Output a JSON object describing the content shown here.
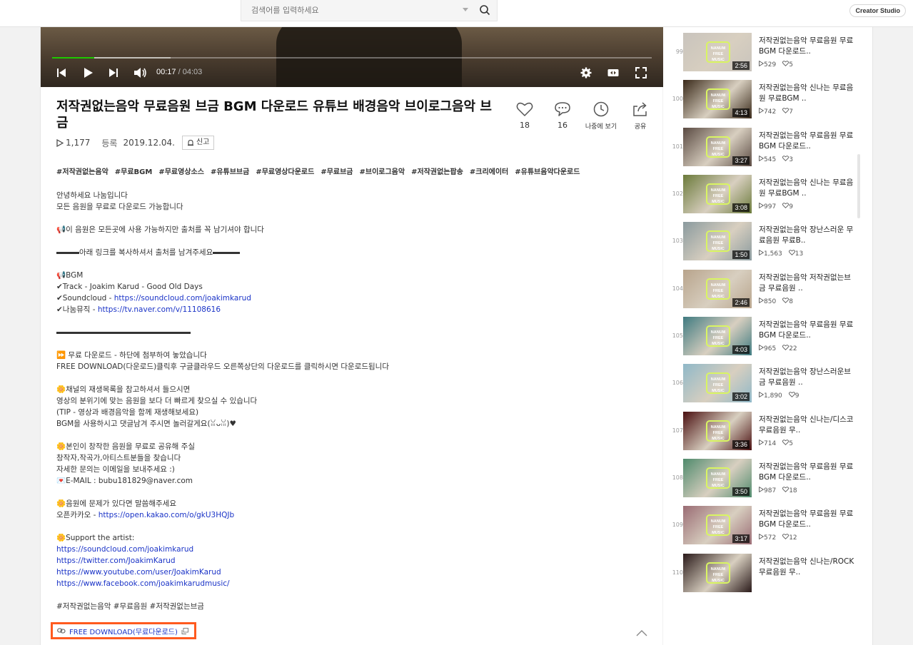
{
  "search": {
    "placeholder": "검색어를 입력하세요"
  },
  "header": {
    "creator_studio": "Creator Studio"
  },
  "player": {
    "current_time": "00:17",
    "separator": "/",
    "total_time": "04:03",
    "progress_fraction": 0.07,
    "buffered_fraction": 0.198
  },
  "video": {
    "title": "저작권없는음악 무료음원 브금 BGM 다운로드 유튜브 배경음악 브이로그음악 브금",
    "views": "1,177",
    "date_label": "등록",
    "date": "2019.12.04.",
    "report_label": "신고"
  },
  "actions": {
    "likes": "18",
    "comments": "16",
    "later_label": "나중에 보기",
    "share_label": "공유"
  },
  "tags": [
    "#저작권없는음악",
    "#무료BGM",
    "#무료영상소스",
    "#유튜브브금",
    "#무료영상다운로드",
    "#무료브금",
    "#브이로그음악",
    "#저작권없는팝송",
    "#크리에이터",
    "#유튜브음악다운로드"
  ],
  "description": {
    "l1": "안녕하세요 나눔입니다",
    "l2": "모든 음원을 무료로 다운로드 가능합니다",
    "l3": "📢이 음원은 모든곳에 사용 가능하지만 출처를 꼭 남기셔야 합니다",
    "l4": "아래 링크를 복사하셔서 출처를 남겨주세요",
    "l5": "📢BGM",
    "l6": "✔Track - Joakim Karud - Good Old Days",
    "l7_prefix": "✔Soundcloud - ",
    "l7_link": "https://soundcloud.com/joakimkarud",
    "l8_prefix": "✔나눔뮤직 - ",
    "l8_link": "https://tv.naver.com/v/11108616",
    "l9": "⏩ 무료 다운로드 - 하단에 첨부하여 놓았습니다",
    "l10": "FREE DOWNLOAD(다운로드)클릭후 구글클라우드 오른쪽상단의 다운로드를 클릭하시면 다운로드됩니다",
    "l11": "🌼채널의 재생목록을 참고하셔서 들으시면",
    "l12": "영상의 분위기에 맞는 음원을 보다 더 빠르게 찾으실 수 있습니다",
    "l13": "(TIP - 영상과 배경음악을 함께 재생해보세요)",
    "l14": "BGM을 사용하시고 댓글남겨 주시면 놀러갈게요(ꈍᴗꈍ)♥",
    "l15": "🌼본인이 창작한 음원을 무료로 공유해 주실",
    "l16": "창작자,작곡가,아티스트분들을 찾습니다",
    "l17": "자세한 문의는 이메일을 보내주세요 :)",
    "l18": "💌E-MAIL : bubu181829@naver.com",
    "l19": "🌼음원에 문제가 있다면 말씀해주세요",
    "l20_prefix": "오픈카카오 - ",
    "l20_link": "https://open.kakao.com/o/gkU3HQJb",
    "l21": "🌼Support the artist:",
    "l22": "https://soundcloud.com/joakimkarud",
    "l23": "https://twitter.com/JoakimKarud",
    "l24": "https://www.youtube.com/user/JoakimKarud",
    "l25": "https://www.facebook.com/joakimkarudmusic/",
    "l26": "#저작권없는음악 #무료음원 #저작권없는브금"
  },
  "download": {
    "label": "FREE DOWNLOAD(무료다운로드)"
  },
  "playlist": [
    {
      "num": "99",
      "title": "저작권없는음악 무료음원 무료 BGM 다운로드..",
      "duration": "2:56",
      "views": "529",
      "likes": "5",
      "bg": "#c9c4bd"
    },
    {
      "num": "100",
      "title": "저작권없는음악 신나는 무료음원 무료BGM ..",
      "duration": "4:13",
      "views": "742",
      "likes": "7",
      "bg": "#3a2a1a"
    },
    {
      "num": "101",
      "title": "저작권없는음악 무료음원 무료 BGM 다운로드..",
      "duration": "3:27",
      "views": "545",
      "likes": "3",
      "bg": "#5a4a42"
    },
    {
      "num": "102",
      "title": "저작권없는음악 신나는 무료음원 무료BGM ..",
      "duration": "3:08",
      "views": "997",
      "likes": "9",
      "bg": "#6b7a3a"
    },
    {
      "num": "103",
      "title": "저작권없는음악 장난스러운 무료음원 무료B..",
      "duration": "1:50",
      "views": "1,563",
      "likes": "13",
      "bg": "#8a9a9e"
    },
    {
      "num": "104",
      "title": "저작권없는음악 저작권없는브금 무료음원 ..",
      "duration": "2:46",
      "views": "850",
      "likes": "8",
      "bg": "#b8a48c"
    },
    {
      "num": "105",
      "title": "저작권없는음악 무료음원 무료 BGM 다운로드..",
      "duration": "4:03",
      "views": "965",
      "likes": "22",
      "bg": "#3f7a80"
    },
    {
      "num": "106",
      "title": "저작권없는음악 장난스러운브금 무료음원 ..",
      "duration": "3:02",
      "views": "1,890",
      "likes": "9",
      "bg": "#8fb8c8"
    },
    {
      "num": "107",
      "title": "저작권없는음악 신나는/디스코 무료음원 무..",
      "duration": "3:36",
      "views": "714",
      "likes": "5",
      "bg": "#4a0f10"
    },
    {
      "num": "108",
      "title": "저작권없는음악 무료음원 무료 BGM 다운로드..",
      "duration": "3:50",
      "views": "987",
      "likes": "18",
      "bg": "#4f8a6c"
    },
    {
      "num": "109",
      "title": "저작권없는음악 무료음원 무료 BGM 다운로드..",
      "duration": "3:17",
      "views": "572",
      "likes": "12",
      "bg": "#9a6c74"
    },
    {
      "num": "110",
      "title": "저작권없는음악 신나는/ROCK 무료음원 무..",
      "duration": "",
      "views": "",
      "likes": "",
      "bg": "#2a1a1a"
    }
  ],
  "logo_text": {
    "l1": "NANUM",
    "l2": "FREE",
    "l3": "MUSIC"
  }
}
